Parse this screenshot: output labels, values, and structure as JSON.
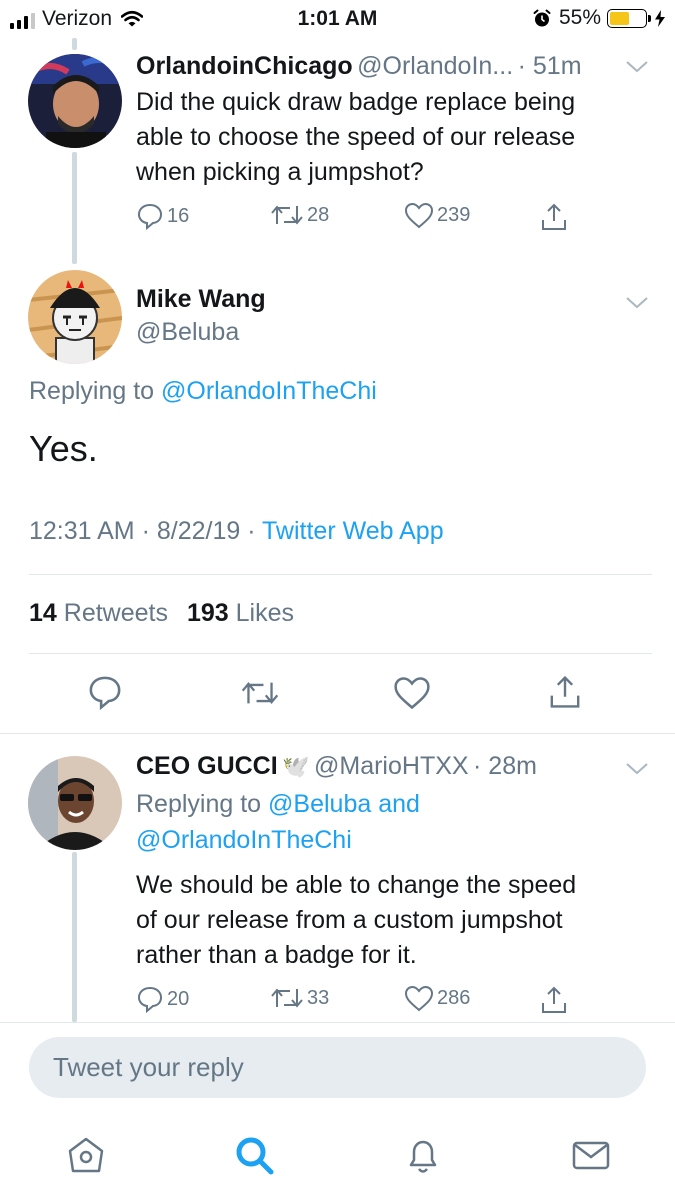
{
  "status_bar": {
    "carrier": "Verizon",
    "time": "1:01 AM",
    "battery": "55%"
  },
  "tweet1": {
    "name": "OrlandoinChicago",
    "handle": "@OrlandoIn...",
    "time": "· 51m",
    "text_lines": [
      "Did the quick draw badge replace being",
      "able to choose the speed of our release",
      "when picking a jumpshot?"
    ],
    "replies": "16",
    "retweets": "28",
    "likes": "239"
  },
  "main_tweet": {
    "name": "Mike Wang",
    "handle": "@Beluba",
    "replying_prefix": "Replying to",
    "replying_handle": "@OrlandoInTheChi",
    "text": "Yes.",
    "timestamp": "12:31 AM · 8/22/19 · ",
    "source": "Twitter Web App",
    "retweets_count": "14",
    "retweets_label": "Retweets",
    "likes_count": "193",
    "likes_label": "Likes"
  },
  "tweet3": {
    "name": "CEO GUCCI",
    "name_emoji": "🕊️",
    "handle": "@MarioHTXX",
    "time": "· 28m",
    "replying_prefix": "Replying to",
    "replying_handle1": "@Beluba",
    "replying_and": "and",
    "replying_handle2": "@OrlandoInTheChi",
    "text_lines": [
      "We should be able to change the speed",
      "of our release from a custom jumpshot",
      "rather than a badge for it."
    ],
    "replies": "20",
    "retweets": "33",
    "likes": "286"
  },
  "reply_box": {
    "placeholder": "Tweet your reply"
  },
  "icons": {
    "status": [
      "signal-icon",
      "wifi-icon",
      "alarm-icon",
      "battery-icon",
      "charging-icon"
    ],
    "tweet_actions": [
      "reply-icon",
      "retweet-icon",
      "like-icon",
      "share-icon"
    ],
    "tabs": [
      "home-icon",
      "search-icon",
      "notifications-icon",
      "messages-icon"
    ]
  },
  "colors": {
    "accent": "#1da1f2",
    "secondary_text": "#657786",
    "battery": "#f5c518"
  }
}
